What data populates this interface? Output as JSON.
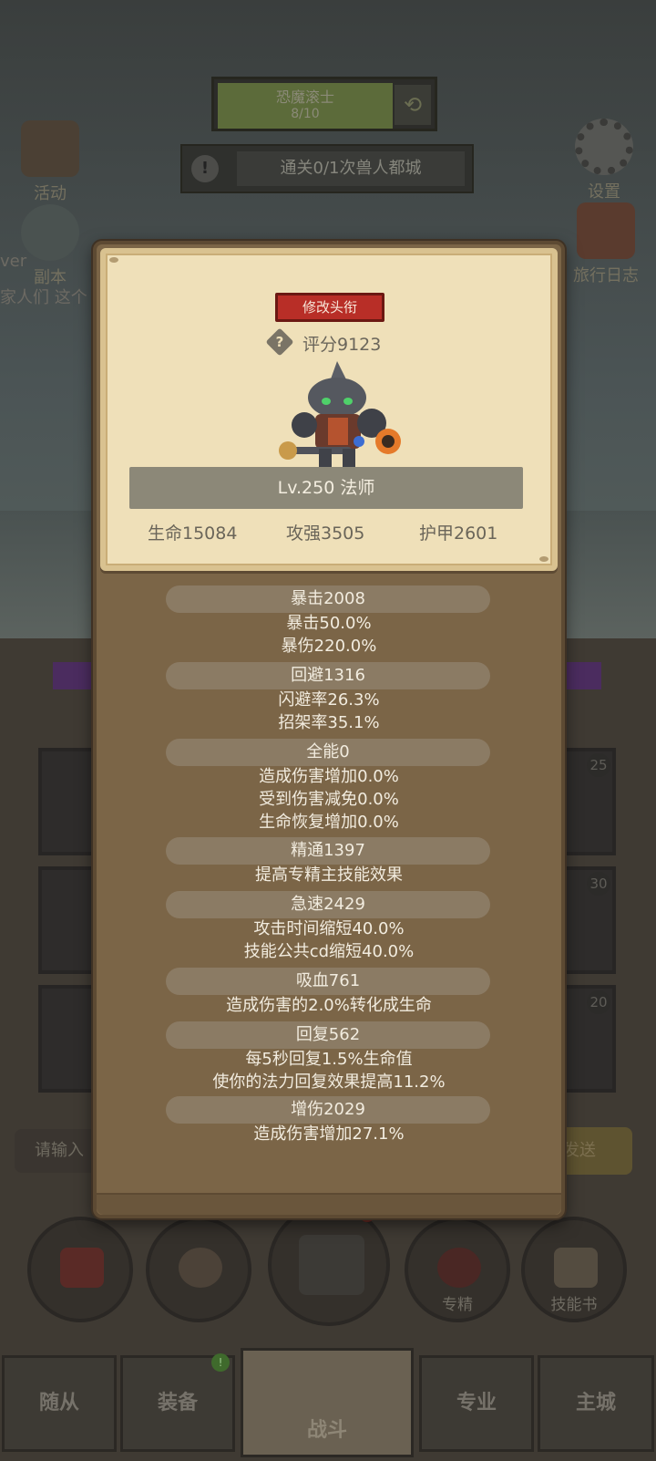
{
  "background": {
    "quest": {
      "name": "恐魔滚士",
      "progress": "8/10"
    },
    "clear_text": "通关0/1次兽人都城",
    "side_buttons": {
      "activity": "活动",
      "dungeon": "副本",
      "settings": "设置",
      "travel_log": "旅行日志"
    },
    "chat_fragments": [
      "ver",
      "家人们 这个"
    ],
    "card_badges": [
      "25",
      "30",
      "20"
    ],
    "chat": {
      "input_placeholder": "请输入",
      "send_label": "发送"
    },
    "action_buttons": {
      "specialization": "专精",
      "skill_book": "技能书"
    },
    "nav_tabs": [
      "随从",
      "装备",
      "战斗",
      "专业",
      "主城"
    ]
  },
  "dialog": {
    "change_title_button": "修改头衔",
    "rating": "评分9123",
    "level_class": "Lv.250 法师",
    "base_stats": [
      "生命15084",
      "攻强3505",
      "护甲2601"
    ],
    "sections": [
      {
        "header": "暴击2008",
        "lines": [
          "暴击50.0%",
          "暴伤220.0%"
        ]
      },
      {
        "header": "回避1316",
        "lines": [
          "闪避率26.3%",
          "招架率35.1%"
        ]
      },
      {
        "header": "全能0",
        "lines": [
          "造成伤害增加0.0%",
          "受到伤害减免0.0%",
          "生命恢复增加0.0%"
        ]
      },
      {
        "header": "精通1397",
        "lines": [
          "提高专精主技能效果"
        ]
      },
      {
        "header": "急速2429",
        "lines": [
          "攻击时间缩短40.0%",
          "技能公共cd缩短40.0%"
        ]
      },
      {
        "header": "吸血761",
        "lines": [
          "造成伤害的2.0%转化成生命"
        ]
      },
      {
        "header": "回复562",
        "lines": [
          "每5秒回复1.5%生命值",
          "使你的法力回复效果提高11.2%"
        ]
      },
      {
        "header": "增伤2029",
        "lines": [
          "造成伤害增加27.1%"
        ]
      }
    ]
  },
  "colors": {
    "dialog_brown": "#7b6547",
    "parchment": "#efe0b9",
    "title_button_red": "#b82e27",
    "stat_header": "#8b7b64"
  }
}
